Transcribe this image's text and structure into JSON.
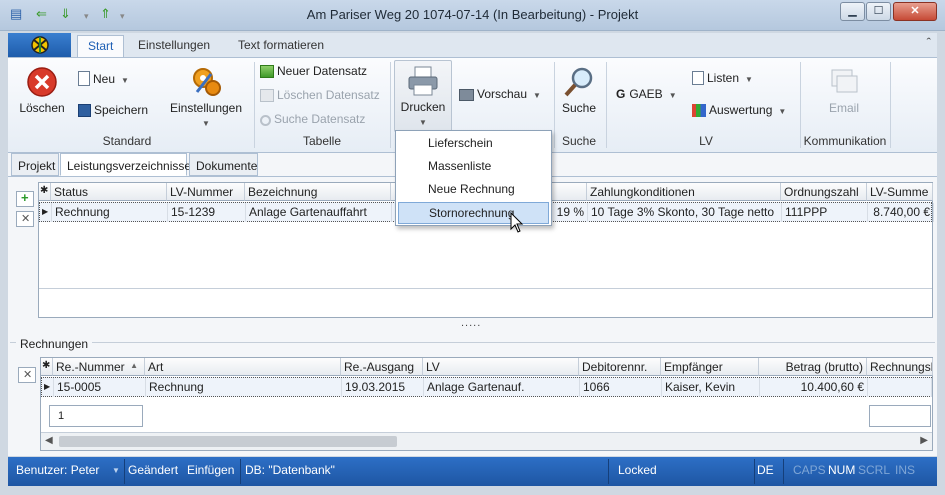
{
  "window": {
    "title": "Am Pariser Weg 20 1074-07-14 (In Bearbeitung) - Projekt"
  },
  "ribbon_tabs": [
    "Start",
    "Einstellungen",
    "Text formatieren"
  ],
  "ribbon": {
    "standard": {
      "delete": "Löschen",
      "new": "Neu",
      "save": "Speichern",
      "settings": "Einstellungen",
      "label": "Standard"
    },
    "tabelle": {
      "new_record": "Neuer Datensatz",
      "delete_record": "Löschen Datensatz",
      "search_record": "Suche Datensatz",
      "label": "Tabelle"
    },
    "drucken": {
      "print": "Drucken",
      "preview": "Vorschau"
    },
    "suche": {
      "search": "Suche",
      "label": "Suche"
    },
    "lv": {
      "gaeb": "GAEB",
      "lists": "Listen",
      "evaluation": "Auswertung",
      "label": "LV"
    },
    "kommunikation": {
      "email": "Email",
      "label": "Kommunikation"
    }
  },
  "print_menu": [
    "Lieferschein",
    "Massenliste",
    "Neue Rechnung",
    "Stornorechnung"
  ],
  "sub_tabs": [
    "Projekt",
    "Leistungsverzeichnisse",
    "Dokumente"
  ],
  "lv_grid": {
    "columns": [
      "Status",
      "LV-Nummer",
      "Bezeichnung",
      "Zahlungkonditionen",
      "Ordnungszahl",
      "LV-Summe"
    ],
    "row": {
      "status": "Rechnung",
      "nummer": "15-1239",
      "bezeichnung": "Anlage Gartenauffahrt",
      "mwst": "19 %",
      "zahlung": "10 Tage 3% Skonto, 30 Tage netto",
      "ordnungszahl": "111PPP",
      "summe": "8.740,00 €"
    }
  },
  "splitter": ".....",
  "rechnungen": {
    "label": "Rechnungen",
    "columns": [
      "Re.-Nummer",
      "Art",
      "Re.-Ausgang",
      "LV",
      "Debitorennr.",
      "Empfänger",
      "Betrag (brutto)",
      "Rechnungsbe"
    ],
    "row": {
      "nummer": "15-0005",
      "art": "Rechnung",
      "ausgang": "19.03.2015",
      "lv": "Anlage Gartenauf.",
      "debitor": "1066",
      "empfaenger": "Kaiser, Kevin",
      "betrag": "10.400,60 €"
    },
    "count": "1"
  },
  "statusbar": {
    "user": "Benutzer: Peter",
    "changed": "Geändert",
    "insert": "Einfügen",
    "db": "DB: \"Datenbank\"",
    "locked": "Locked",
    "lang": "DE",
    "caps": "CAPS",
    "num": "NUM",
    "scrl": "SCRL",
    "ins": "INS"
  }
}
